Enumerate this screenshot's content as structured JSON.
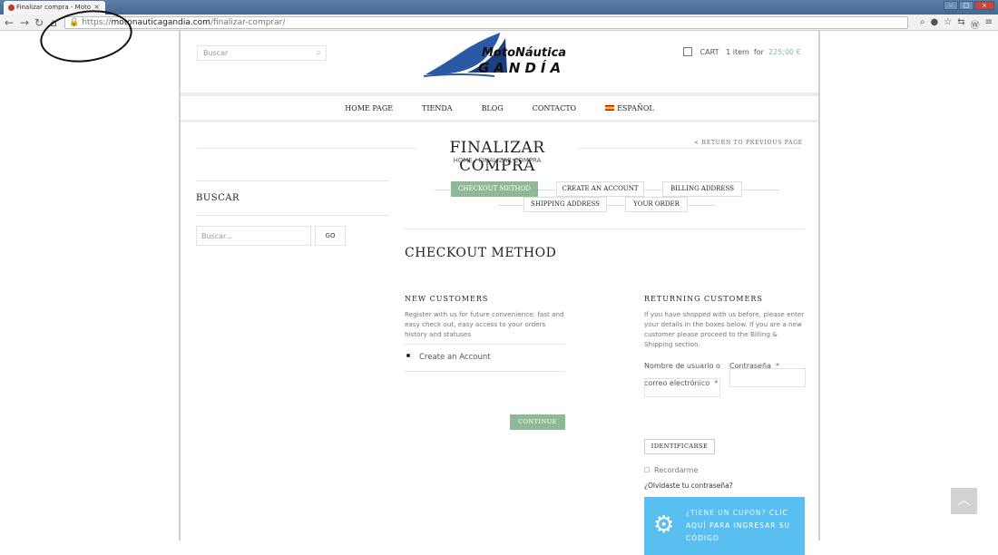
{
  "browser": {
    "tab_title": "Finalizar compra - Moto",
    "tab_close": "×",
    "url_prefix": "https://",
    "url_domain": "motonauticagandia.com",
    "url_path": "/finalizar-comprar/"
  },
  "header": {
    "search_placeholder": "Buscar",
    "logo_line1": "MotoNáutica",
    "logo_line2": "GANDÍA",
    "cart_label": "CART",
    "cart_items": "1 item",
    "cart_for": "for",
    "cart_total": "225,00 €"
  },
  "nav": {
    "items": [
      "HOME PAGE",
      "TIENDA",
      "BLOG",
      "CONTACTO"
    ],
    "language": "ESPAÑOL"
  },
  "page": {
    "title": "FINALIZAR COMPRA",
    "breadcrumb": "HOME / FINALIZAR COMPRA",
    "return_link": "< RETURN TO PREVIOUS PAGE"
  },
  "sidebar": {
    "heading": "BUSCAR",
    "search_placeholder": "Buscar...",
    "go_label": "GO"
  },
  "steps": [
    "CHECKOUT METHOD",
    "CREATE AN ACCOUNT",
    "BILLING ADDRESS",
    "SHIPPING ADDRESS",
    "YOUR ORDER"
  ],
  "checkout": {
    "heading": "CHECKOUT METHOD",
    "new_customers": {
      "heading": "NEW CUSTOMERS",
      "text": "Register with us for future convenience: fast and easy check out, easy access to your orders history and statuses",
      "option": "Create an Account",
      "continue_label": "CONTINUE"
    },
    "returning_customers": {
      "heading": "RETURNING CUSTOMERS",
      "text": "If you have shopped with us before, please enter your details in the boxes below. If you are a new customer please proceed to the Billing & Shipping section.",
      "username_label": "Nombre de usuario o correo electrónico",
      "password_label": "Contraseña",
      "required_mark": "*",
      "login_label": "IDENTIFICARSE",
      "remember_label": "Recordarme",
      "lost_password": "¿Olvidaste tu contraseña?"
    },
    "coupon": {
      "question": "¿TIENE UN CUPÓN?",
      "link": "CLIC AQUÍ PARA INGRESAR SU CÓDIGO"
    }
  },
  "colors": {
    "accent_green": "#8fb996",
    "coupon_blue": "#58bff0",
    "price_green": "#83b995"
  }
}
